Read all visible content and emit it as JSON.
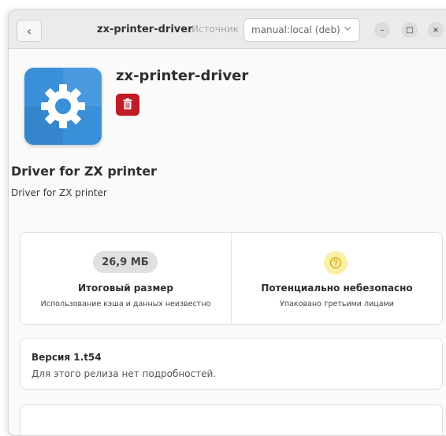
{
  "header": {
    "back_glyph": "‹",
    "title": "zx-printer-driver",
    "source_label": "Источник",
    "source_value": "manual:local (deb)",
    "minimize_glyph": "–",
    "maximize_glyph": "□",
    "close_glyph": "×"
  },
  "app": {
    "name": "zx-printer-driver",
    "summary": "Driver for ZX printer",
    "description": "Driver for ZX printer",
    "icon": "gear-icon"
  },
  "size_info": {
    "value": "26,9 МБ",
    "title": "Итоговый размер",
    "subtitle": "Использование кэша и данных неизвестно"
  },
  "safety_info": {
    "title": "Потенциально небезопасно",
    "subtitle": "Упаковано третьими лицами"
  },
  "version": {
    "title": "Версия 1.t54",
    "subtitle": "Для этого релиза нет подробностей."
  },
  "colors": {
    "accent_delete": "#c01c28",
    "icon_blue": "#3a8fd9",
    "warning_bg": "#f9f0a6",
    "warning_fg": "#d0a000"
  }
}
